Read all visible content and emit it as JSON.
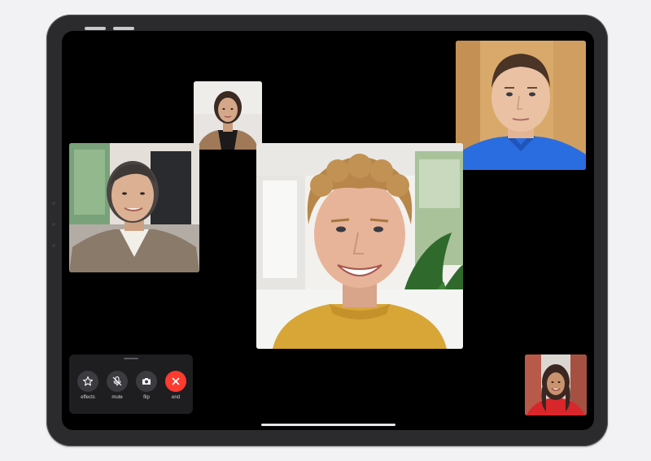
{
  "controls": {
    "effects_label": "effects",
    "mute_label": "mute",
    "flip_label": "flip",
    "end_label": "end"
  },
  "icons": {
    "effects": "star-icon",
    "mute": "microphone-slash-icon",
    "flip": "camera-flip-icon",
    "end": "close-icon"
  },
  "colors": {
    "end_button": "#ff3b30",
    "control_button": "#3c3c40",
    "screen_background": "#000000"
  }
}
